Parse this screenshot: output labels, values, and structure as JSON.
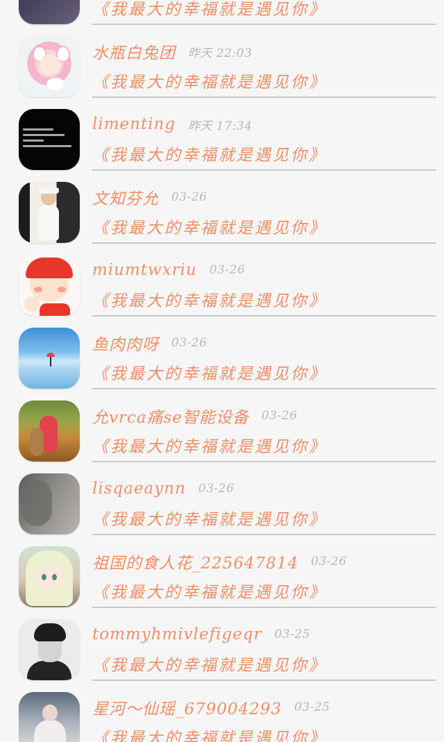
{
  "items": [
    {
      "name": "",
      "time": "",
      "message": "《我最大的幸福就是遇见你》",
      "avatar": "bookshelf-photo"
    },
    {
      "name": "水瓶白兔团",
      "time": "昨天 22:03",
      "message": "《我最大的幸福就是遇见你》",
      "avatar": "anime-girl-pig"
    },
    {
      "name": "limenting",
      "time": "昨天 17:34",
      "message": "《我最大的幸福就是遇见你》",
      "avatar": "black-text-card"
    },
    {
      "name": "文知芬允",
      "time": "03-26",
      "message": "《我最大的幸福就是遇见你》",
      "avatar": "woman-white-dress"
    },
    {
      "name": "miumtwxriu",
      "time": "03-26",
      "message": "《我最大的幸福就是遇见你》",
      "avatar": "cartoon-boy-red-cap"
    },
    {
      "name": "鱼肉肉呀",
      "time": "03-26",
      "message": "《我最大的幸福就是遇见你》",
      "avatar": "sky-umbrella"
    },
    {
      "name": "允vrca痛se智能设备",
      "time": "03-26",
      "message": "《我最大的幸福就是遇见你》",
      "avatar": "child-autumn"
    },
    {
      "name": "lisqaeaynn",
      "time": "03-26",
      "message": "《我最大的幸福就是遇见你》",
      "avatar": "gray-blur"
    },
    {
      "name": "祖国的食人花_225647814",
      "time": "03-26",
      "message": "《我最大的幸福就是遇见你》",
      "avatar": "anime-girl-green-eyes"
    },
    {
      "name": "tommyhmivlefigeqr",
      "time": "03-25",
      "message": "《我最大的幸福就是遇见你》",
      "avatar": "young-man-bw"
    },
    {
      "name": "星河～仙瑶_679004293",
      "time": "03-25",
      "message": "《我最大的幸福就是遇见你》",
      "avatar": "girl-library"
    }
  ],
  "colors": {
    "accent": "#ef8f66",
    "time": "#b9b7b7",
    "divider": "#c9c7c7",
    "background": "#f7f6f6"
  }
}
